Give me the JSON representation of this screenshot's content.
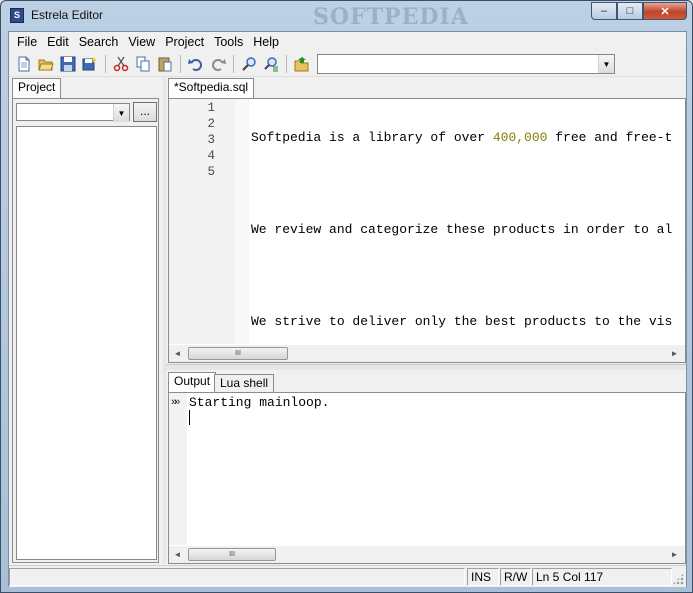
{
  "window": {
    "title": "Estrela Editor",
    "icon_label": "S",
    "watermark": "SOFTPEDIA",
    "controls": {
      "minimize": "–",
      "maximize": "□",
      "close": "✕"
    }
  },
  "menu": {
    "items": [
      "File",
      "Edit",
      "Search",
      "View",
      "Project",
      "Tools",
      "Help"
    ]
  },
  "toolbar": {
    "icons": [
      "new-file",
      "open-file",
      "save",
      "save-all",
      "cut",
      "copy",
      "paste",
      "undo",
      "redo",
      "find",
      "find-in-files",
      "open-project"
    ],
    "combo_value": ""
  },
  "project_panel": {
    "tab_label": "Project",
    "browse_label": "..."
  },
  "editor": {
    "tab_label": "*Softpedia.sql",
    "line_numbers": [
      "1",
      "2",
      "3",
      "4",
      "5"
    ],
    "lines": [
      {
        "pre": "Softpedia is a library of over ",
        "num": "400,000",
        "post": " free and free-t"
      },
      {
        "pre": "",
        "num": "",
        "post": ""
      },
      {
        "pre": "We review and categorize these products in order to al",
        "num": "",
        "post": ""
      },
      {
        "pre": "",
        "num": "",
        "post": ""
      },
      {
        "pre": "We strive to deliver only the best products to the vis",
        "num": "",
        "post": ""
      }
    ],
    "scroll_thumb": "III"
  },
  "output": {
    "tabs": [
      "Output",
      "Lua shell"
    ],
    "prompt_marker": "»»",
    "text": "Starting mainloop.",
    "scroll_thumb": "III"
  },
  "status": {
    "mode": "INS",
    "access": "R/W",
    "position": "Ln 5 Col 117"
  },
  "colors": {
    "number_literal": "#7f7f00"
  }
}
